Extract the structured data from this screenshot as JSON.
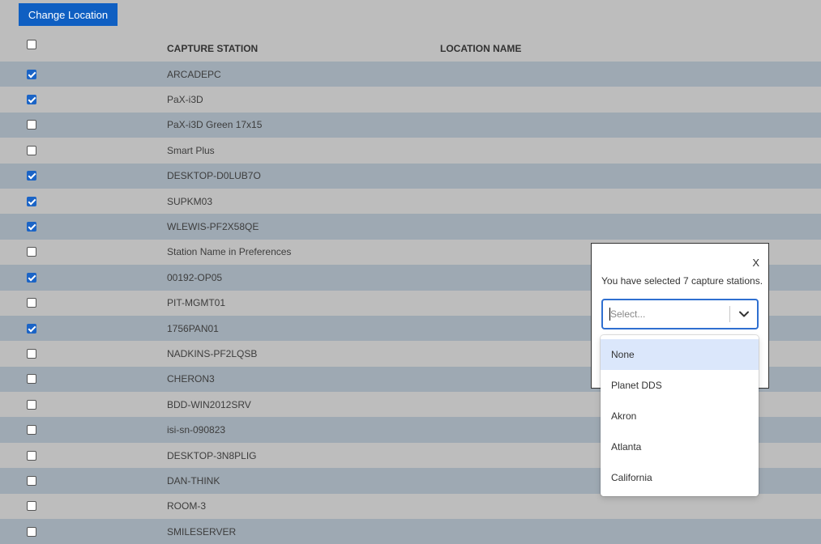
{
  "toolbar": {
    "change_location_label": "Change Location"
  },
  "table": {
    "columns": [
      "CAPTURE STATION",
      "LOCATION NAME"
    ],
    "rows": [
      {
        "station": "ARCADEPC",
        "checked": true
      },
      {
        "station": "PaX-i3D",
        "checked": true
      },
      {
        "station": "PaX-i3D Green 17x15",
        "checked": false
      },
      {
        "station": "Smart Plus",
        "checked": false
      },
      {
        "station": "DESKTOP-D0LUB7O",
        "checked": true
      },
      {
        "station": "SUPKM03",
        "checked": true
      },
      {
        "station": "WLEWIS-PF2X58QE",
        "checked": true
      },
      {
        "station": "Station Name in Preferences",
        "checked": false
      },
      {
        "station": "00192-OP05",
        "checked": true
      },
      {
        "station": "PIT-MGMT01",
        "checked": false
      },
      {
        "station": "1756PAN01",
        "checked": true
      },
      {
        "station": "NADKINS-PF2LQSB",
        "checked": false
      },
      {
        "station": "CHERON3",
        "checked": false
      },
      {
        "station": "BDD-WIN2012SRV",
        "checked": false
      },
      {
        "station": "isi-sn-090823",
        "checked": false
      },
      {
        "station": "DESKTOP-3N8PLIG",
        "checked": false
      },
      {
        "station": "DAN-THINK",
        "checked": false
      },
      {
        "station": "ROOM-3",
        "checked": false
      },
      {
        "station": "SMILESERVER",
        "checked": false
      }
    ]
  },
  "modal": {
    "close_label": "X",
    "message": "You have selected 7 capture stations.",
    "select": {
      "placeholder": "Select...",
      "options": [
        "None",
        "Planet DDS",
        "Akron",
        "Atlanta",
        "California"
      ],
      "highlighted_index": 0
    }
  },
  "colors": {
    "accent": "#0f5fc2",
    "row_shade": "#9ea9b3",
    "page_bg": "#bdbdbd",
    "option_highlight": "#dbe7fb"
  }
}
